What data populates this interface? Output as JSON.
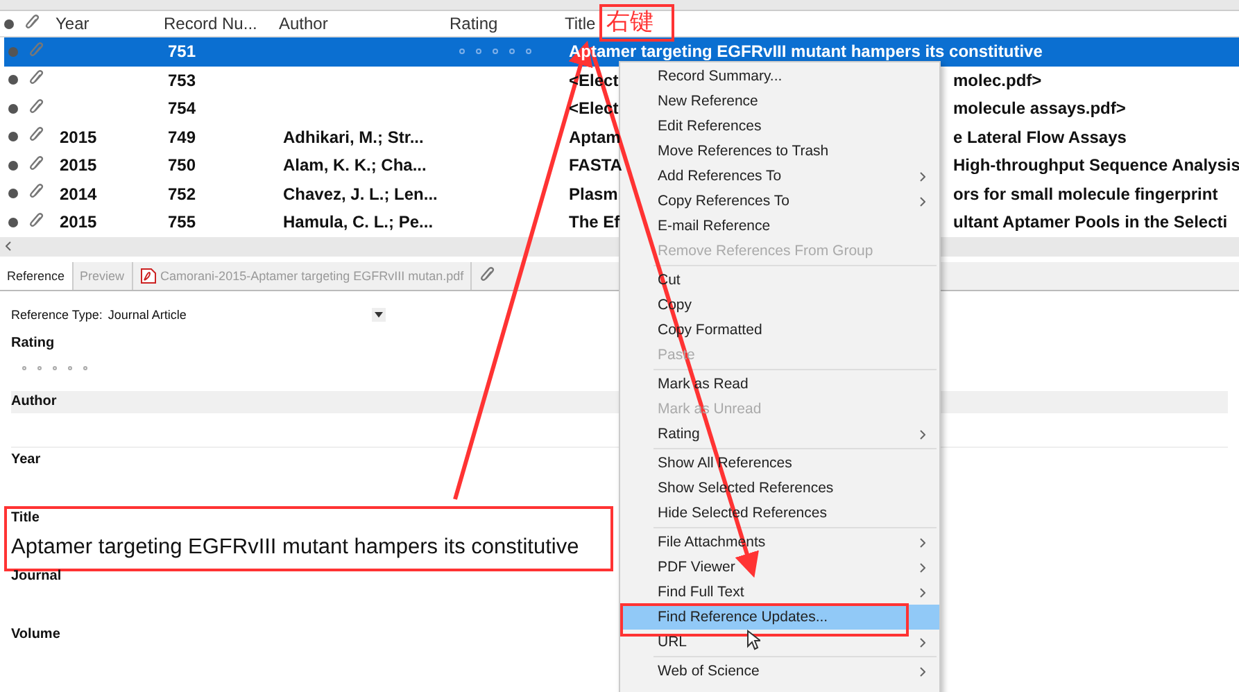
{
  "table": {
    "columns": [
      "Year",
      "Record Nu...",
      "Author",
      "Rating",
      "Title"
    ],
    "rows": [
      {
        "year": "",
        "record": "751",
        "author": "",
        "stars": 0,
        "title_left": "Aptamer targeting EGFRvIII mutant hampers its constitutive",
        "title_right": "",
        "selected": true
      },
      {
        "year": "",
        "record": "753",
        "author": "",
        "title_left": "<Elect",
        "title_right": "molec.pdf>",
        "selected": false
      },
      {
        "year": "",
        "record": "754",
        "author": "",
        "title_left": "<Elect",
        "title_right": "molecule assays.pdf>",
        "selected": false
      },
      {
        "year": "2015",
        "record": "749",
        "author": "Adhikari, M.; Str...",
        "title_left": "Aptam",
        "title_right": "e Lateral Flow Assays",
        "selected": false
      },
      {
        "year": "2015",
        "record": "750",
        "author": "Alam, K. K.; Cha...",
        "title_left": "FASTA",
        "title_right": "High-throughput Sequence Analysis",
        "selected": false
      },
      {
        "year": "2014",
        "record": "752",
        "author": "Chavez, J. L.; Len...",
        "title_left": "Plasm",
        "title_right": "ors for small molecule fingerprint",
        "selected": false
      },
      {
        "year": "2015",
        "record": "755",
        "author": "Hamula, C. L.; Pe...",
        "title_left": "The Ef",
        "title_right": "ultant Aptamer Pools in the Selecti",
        "selected": false
      }
    ]
  },
  "tabs": [
    {
      "label": "Reference",
      "selected": true,
      "kind": "plain"
    },
    {
      "label": "Preview",
      "selected": false,
      "kind": "plain"
    },
    {
      "label": "Camorani-2015-Aptamer targeting EGFRvIII mutan.pdf",
      "selected": false,
      "kind": "pdf"
    }
  ],
  "reference": {
    "type_label": "Reference Type:",
    "type_value": "Journal Article",
    "fields": [
      {
        "label": "Rating",
        "kind": "rating",
        "stars": 0
      },
      {
        "label": "Author",
        "kind": "shaded"
      },
      {
        "label": "Year",
        "kind": "plain"
      },
      {
        "label": "Title",
        "kind": "plain",
        "value": "Aptamer targeting EGFRvIII mutant hampers its constitutive"
      },
      {
        "label": "Journal",
        "kind": "plain"
      },
      {
        "label": "Volume",
        "kind": "plain"
      }
    ]
  },
  "context_menu": {
    "groups": [
      [
        {
          "label": "Record Summary...",
          "disabled": false,
          "submenu": false,
          "selected": false
        },
        {
          "label": "New Reference",
          "disabled": false,
          "submenu": false,
          "selected": false
        },
        {
          "label": "Edit References",
          "disabled": false,
          "submenu": false,
          "selected": false
        },
        {
          "label": "Move References to Trash",
          "disabled": false,
          "submenu": false,
          "selected": false
        },
        {
          "label": "Add References To",
          "disabled": false,
          "submenu": true,
          "selected": false
        },
        {
          "label": "Copy References To",
          "disabled": false,
          "submenu": true,
          "selected": false
        },
        {
          "label": "E-mail Reference",
          "disabled": false,
          "submenu": false,
          "selected": false
        },
        {
          "label": "Remove References From Group",
          "disabled": true,
          "submenu": false,
          "selected": false
        }
      ],
      [
        {
          "label": "Cut",
          "disabled": false,
          "submenu": false,
          "selected": false
        },
        {
          "label": "Copy",
          "disabled": false,
          "submenu": false,
          "selected": false
        },
        {
          "label": "Copy Formatted",
          "disabled": false,
          "submenu": false,
          "selected": false
        },
        {
          "label": "Paste",
          "disabled": true,
          "submenu": false,
          "selected": false
        }
      ],
      [
        {
          "label": "Mark as Read",
          "disabled": false,
          "submenu": false,
          "selected": false
        },
        {
          "label": "Mark as Unread",
          "disabled": true,
          "submenu": false,
          "selected": false
        },
        {
          "label": "Rating",
          "disabled": false,
          "submenu": true,
          "selected": false
        }
      ],
      [
        {
          "label": "Show All References",
          "disabled": false,
          "submenu": false,
          "selected": false
        },
        {
          "label": "Show Selected References",
          "disabled": false,
          "submenu": false,
          "selected": false
        },
        {
          "label": "Hide Selected References",
          "disabled": false,
          "submenu": false,
          "selected": false
        }
      ],
      [
        {
          "label": "File Attachments",
          "disabled": false,
          "submenu": true,
          "selected": false
        },
        {
          "label": "PDF Viewer",
          "disabled": false,
          "submenu": true,
          "selected": false
        },
        {
          "label": "Find Full Text",
          "disabled": false,
          "submenu": true,
          "selected": false
        },
        {
          "label": "Find Reference Updates...",
          "disabled": false,
          "submenu": false,
          "selected": true
        },
        {
          "label": "URL",
          "disabled": false,
          "submenu": true,
          "selected": false
        }
      ],
      [
        {
          "label": "Web of Science",
          "disabled": false,
          "submenu": true,
          "selected": false
        }
      ]
    ]
  },
  "annotation": {
    "label": "右键"
  }
}
